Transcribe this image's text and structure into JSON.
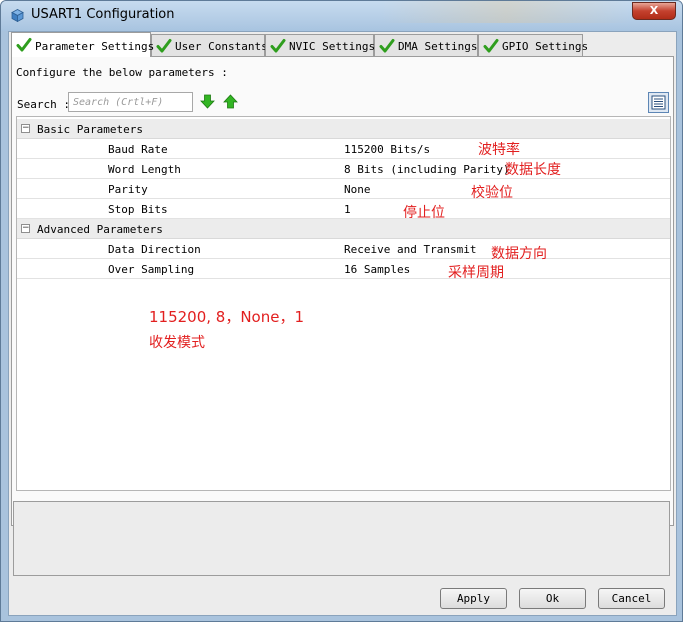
{
  "window": {
    "title": "USART1 Configuration",
    "close_label": "X"
  },
  "tabs": [
    {
      "label": "Parameter Settings",
      "active": true
    },
    {
      "label": "User Constants",
      "active": false
    },
    {
      "label": "NVIC Settings",
      "active": false
    },
    {
      "label": "DMA Settings",
      "active": false
    },
    {
      "label": "GPIO Settings",
      "active": false
    }
  ],
  "panel": {
    "configure_text": "Configure the below parameters :",
    "search_label": "Search :",
    "search_placeholder": "Search (Crtl+F)"
  },
  "groups": [
    {
      "label": "Basic Parameters",
      "collapse_glyph": "−",
      "rows": [
        {
          "name": "Baud Rate",
          "value": "115200 Bits/s"
        },
        {
          "name": "Word Length",
          "value": "8 Bits (including Parity)"
        },
        {
          "name": "Parity",
          "value": "None"
        },
        {
          "name": "Stop Bits",
          "value": "1"
        }
      ]
    },
    {
      "label": "Advanced Parameters",
      "collapse_glyph": "−",
      "rows": [
        {
          "name": "Data Direction",
          "value": "Receive and Transmit"
        },
        {
          "name": "Over Sampling",
          "value": "16 Samples"
        }
      ]
    }
  ],
  "annotations": {
    "baud_rate": "波特率",
    "word_length": "数据长度",
    "parity": "校验位",
    "stop_bits": "停止位",
    "data_direction": "数据方向",
    "over_sampling": "采样周期",
    "summary_line1": "115200, 8，None，1",
    "summary_line2": "收发模式"
  },
  "buttons": {
    "apply": "Apply",
    "ok": "Ok",
    "cancel": "Cancel"
  },
  "colors": {
    "annotation_red": "#e21f1f",
    "check_green": "#2f9e1e",
    "arrow_green": "#32b523"
  }
}
